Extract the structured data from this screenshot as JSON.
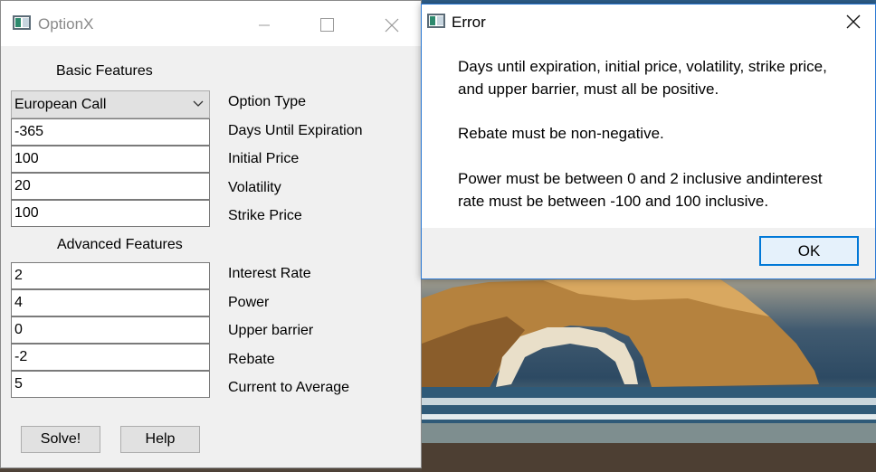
{
  "main_window": {
    "title": "OptionX",
    "basic_features_label": "Basic Features",
    "option_type": {
      "selected": "European Call",
      "label": "Option Type"
    },
    "basic_fields": [
      {
        "value": "-365",
        "label": "Days Until Expiration"
      },
      {
        "value": "100",
        "label": "Initial Price"
      },
      {
        "value": "20",
        "label": "Volatility"
      },
      {
        "value": "100",
        "label": "Strike Price"
      }
    ],
    "advanced_features_label": "Advanced Features",
    "advanced_fields": [
      {
        "value": "2",
        "label": "Interest Rate"
      },
      {
        "value": "4",
        "label": "Power"
      },
      {
        "value": "0",
        "label": "Upper barrier"
      },
      {
        "value": "-2",
        "label": "Rebate"
      },
      {
        "value": "5",
        "label": "Current to Average"
      }
    ],
    "solve_label": "Solve!",
    "help_label": "Help"
  },
  "error_dialog": {
    "title": "Error",
    "lines": [
      "Days until expiration, initial price, volatility, strike price,",
      "and upper barrier, must all be positive.",
      "Rebate must be non-negative.",
      "Power must be between 0 and 2 inclusive andinterest",
      "rate must be between -100 and 100 inclusive."
    ],
    "ok_label": "OK"
  },
  "icons": [
    "app-window-icon",
    "minimize-icon",
    "maximize-icon",
    "close-icon",
    "chevron-down-icon"
  ],
  "colors": {
    "accent": "#0078d7",
    "dialog_border": "#2b79d4",
    "window_bg": "#f0f0f0"
  }
}
